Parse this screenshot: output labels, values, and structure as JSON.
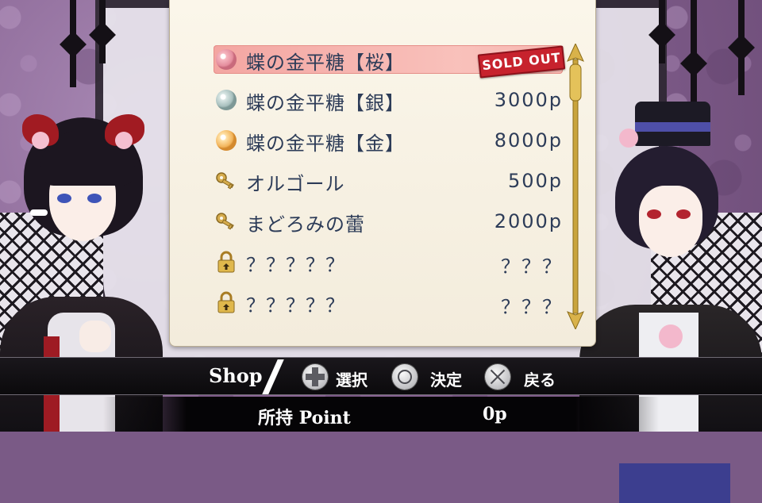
{
  "shop": {
    "items": [
      {
        "name": "蝶の金平糖【桜】",
        "price": "____p",
        "icon": "pink-candy-icon",
        "selected": true,
        "sold_out": true
      },
      {
        "name": "蝶の金平糖【銀】",
        "price": "3000p",
        "icon": "silver-candy-icon"
      },
      {
        "name": "蝶の金平糖【金】",
        "price": "8000p",
        "icon": "gold-candy-icon"
      },
      {
        "name": "オルゴール",
        "price": "500p",
        "icon": "key-icon"
      },
      {
        "name": "まどろみの蕾",
        "price": "2000p",
        "icon": "key-icon"
      },
      {
        "name": "？？？？？",
        "price": "？？？",
        "icon": "lock-icon"
      },
      {
        "name": "？？？？？",
        "price": "？？？",
        "icon": "lock-icon"
      }
    ],
    "sold_out_label": "SOLD OUT"
  },
  "controls": {
    "title": "Shop",
    "select_label": "選択",
    "confirm_label": "決定",
    "back_label": "戻る"
  },
  "points": {
    "label": "所持 Point",
    "value": "0p"
  },
  "colors": {
    "selected_row": "#f3a6a2",
    "panel": "#fbf6ea",
    "text": "#2d3c58",
    "sold_out": "#c7222d"
  }
}
